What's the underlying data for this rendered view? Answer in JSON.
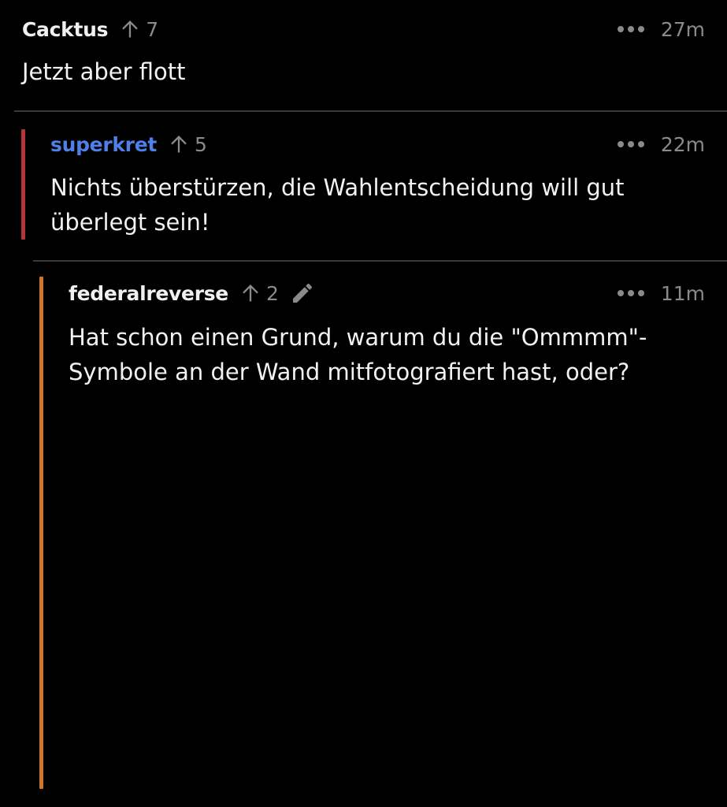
{
  "comments": [
    {
      "author": "Cacktus",
      "author_color": "#f0f0f0",
      "score": "7",
      "time": "27m",
      "body": "Jetzt aber flott",
      "edited": false
    },
    {
      "author": "superkret",
      "author_color": "#4f7fe8",
      "thread_color": "#b5333a",
      "score": "5",
      "time": "22m",
      "body": "Nichts überstürzen, die Wahlentscheidung will gut überlegt sein!",
      "edited": false
    },
    {
      "author": "federalreverse",
      "author_color": "#f0f0f0",
      "thread_color": "#d0762a",
      "score": "2",
      "time": "11m",
      "body": "Hat schon einen Grund, warum du die \"Ommmm\"-Symbole an der Wand mitfotografiert hast, oder?",
      "edited": true
    }
  ],
  "icons": {
    "upvote": "arrow-up-icon",
    "more": "more-options-icon",
    "edit": "pencil-icon"
  },
  "colors": {
    "background": "#000000",
    "divider": "#3a3a3a",
    "meta_text": "#8a8a8a"
  }
}
